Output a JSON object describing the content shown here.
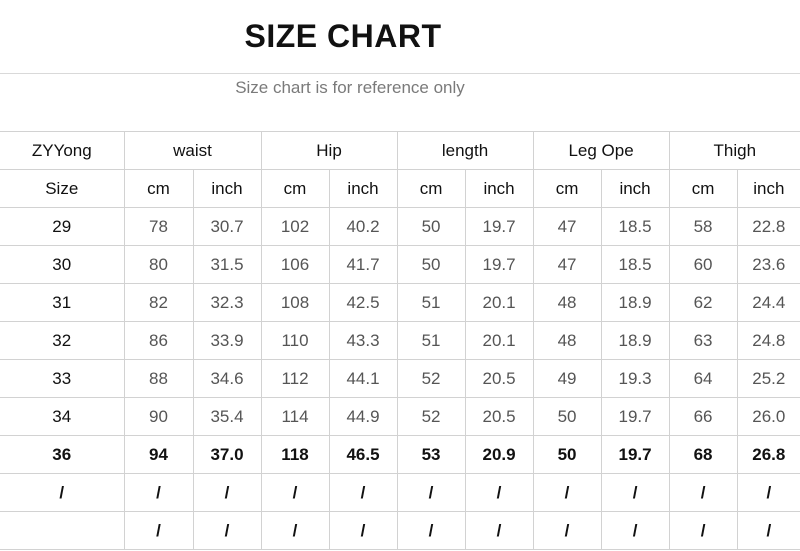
{
  "title": "SIZE CHART",
  "subtitle": "Size chart is for reference only",
  "table": {
    "brand_label": "ZYYong",
    "size_label": "Size",
    "groups": [
      "waist",
      "Hip",
      "length",
      "Leg Ope",
      "Thigh"
    ],
    "units": [
      "cm",
      "inch"
    ],
    "rows": [
      [
        "29",
        "78",
        "30.7",
        "102",
        "40.2",
        "50",
        "19.7",
        "47",
        "18.5",
        "58",
        "22.8"
      ],
      [
        "30",
        "80",
        "31.5",
        "106",
        "41.7",
        "50",
        "19.7",
        "47",
        "18.5",
        "60",
        "23.6"
      ],
      [
        "31",
        "82",
        "32.3",
        "108",
        "42.5",
        "51",
        "20.1",
        "48",
        "18.9",
        "62",
        "24.4"
      ],
      [
        "32",
        "86",
        "33.9",
        "110",
        "43.3",
        "51",
        "20.1",
        "48",
        "18.9",
        "63",
        "24.8"
      ],
      [
        "33",
        "88",
        "34.6",
        "112",
        "44.1",
        "52",
        "20.5",
        "49",
        "19.3",
        "64",
        "25.2"
      ],
      [
        "34",
        "90",
        "35.4",
        "114",
        "44.9",
        "52",
        "20.5",
        "50",
        "19.7",
        "66",
        "26.0"
      ],
      [
        "36",
        "94",
        "37.0",
        "118",
        "46.5",
        "53",
        "20.9",
        "50",
        "19.7",
        "68",
        "26.8"
      ],
      [
        "/",
        "/",
        "/",
        "/",
        "/",
        "/",
        "/",
        "/",
        "/",
        "/",
        "/"
      ],
      [
        "",
        "/",
        "/",
        "/",
        "/",
        "/",
        "/",
        "/",
        "/",
        "/",
        "/"
      ]
    ],
    "bold_row_index": 6
  }
}
